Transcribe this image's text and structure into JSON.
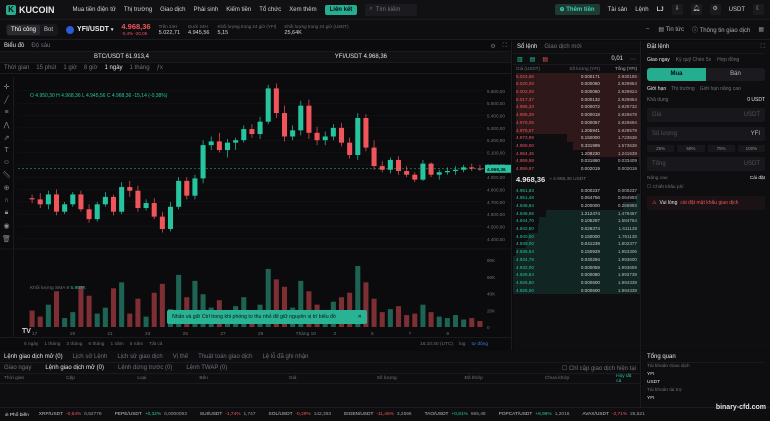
{
  "topnav": {
    "logo": "KUCOIN",
    "items": [
      "Mua tiền điện tử",
      "Thị trường",
      "Giao dịch",
      "Phái sinh",
      "Kiếm tiền",
      "Tổ chức",
      "Xem thêm"
    ],
    "link": "Liên kết",
    "search_placeholder": "Tìm kiếm",
    "deposit": "Thêm tiền",
    "assets": "Tài sản",
    "orders": "Lệnh",
    "user": "LJ",
    "currency": "USDT"
  },
  "tickerbar": {
    "tab_main": "Thủ công",
    "tab_bot": "Bot",
    "pair": "YFI/USDT",
    "price": "4.968,36",
    "change": "-0,4% -20,05",
    "stats": [
      {
        "k": "Trên 24H",
        "v": "5.022,71"
      },
      {
        "k": "Dưới 24H",
        "v": "4.945,56"
      },
      {
        "k": "Khối lượng trong 24 giờ (YFI)",
        "v": "5,15"
      },
      {
        "k": "Khối lượng trong 24 giờ (USDT)",
        "v": "25,64K"
      }
    ],
    "news": "Tin tức",
    "info": "Thông tin giao dịch"
  },
  "chart": {
    "tabs": [
      "Biểu đồ",
      "Độ sâu"
    ],
    "symbol_left": "BTC/USDT 61.913,4",
    "symbol_mid": "YFI/USDT 4.968,36",
    "intervals": [
      "Thời gian",
      "15 phút",
      "1 giờ",
      "8 giờ",
      "1 ngày",
      "1 tháng"
    ],
    "ohlc": "O 4.950,30 H 4.968,36 L 4.945,56 C 4.968,36 -15,14 (-0,38%)",
    "volume_label": "Khối lượng SMA 9",
    "volume_value": "5.907K",
    "current_price_tag": "4.968,36",
    "timestamp": "16:10:40 (UTC)",
    "range_buttons": [
      "5 ngày",
      "1 tháng",
      "3 tháng",
      "6 tháng",
      "1 năm",
      "5 năm",
      "Tất cả"
    ],
    "log_label": "log",
    "auto_label": "tự động"
  },
  "chart_data": {
    "type": "candlestick",
    "x": [
      "17",
      "19",
      "21",
      "23",
      "25",
      "27",
      "29",
      "Tháng 10",
      "3",
      "5",
      "7",
      "9"
    ],
    "y_ticks": [
      "5.600,00",
      "5.500,00",
      "5.400,00",
      "5.300,00",
      "5.200,00",
      "5.100,00",
      "5.000,00",
      "4.900,00",
      "4.800,00",
      "4.700,00",
      "4.600,00",
      "4.500,00",
      "4.400,00"
    ],
    "vol_ticks": [
      "80K",
      "60K",
      "40K",
      "20K",
      "0"
    ],
    "ylim": [
      4350,
      5680
    ],
    "candles": [
      [
        4730,
        4760,
        4690,
        4720
      ],
      [
        4720,
        4770,
        4650,
        4680
      ],
      [
        4680,
        4790,
        4640,
        4760
      ],
      [
        4760,
        4800,
        4590,
        4620
      ],
      [
        4620,
        4700,
        4600,
        4680
      ],
      [
        4680,
        4780,
        4660,
        4760
      ],
      [
        4760,
        4790,
        4620,
        4640
      ],
      [
        4640,
        4680,
        4530,
        4560
      ],
      [
        4560,
        4700,
        4540,
        4680
      ],
      [
        4680,
        4780,
        4660,
        4740
      ],
      [
        4740,
        4760,
        4590,
        4620
      ],
      [
        4620,
        4860,
        4600,
        4820
      ],
      [
        4820,
        4870,
        4740,
        4790
      ],
      [
        4790,
        4830,
        4620,
        4650
      ],
      [
        4650,
        4720,
        4630,
        4690
      ],
      [
        4690,
        4730,
        4560,
        4580
      ],
      [
        4580,
        4620,
        4450,
        4480
      ],
      [
        4480,
        4700,
        4460,
        4660
      ],
      [
        4660,
        4900,
        4640,
        4870
      ],
      [
        4870,
        4900,
        4720,
        4750
      ],
      [
        4750,
        4920,
        4720,
        4890
      ],
      [
        4890,
        5200,
        4850,
        5160
      ],
      [
        5160,
        5230,
        5120,
        5190
      ],
      [
        5190,
        5260,
        5100,
        5120
      ],
      [
        5120,
        5210,
        5060,
        5180
      ],
      [
        5180,
        5220,
        5120,
        5200
      ],
      [
        5200,
        5320,
        5180,
        5290
      ],
      [
        5290,
        5330,
        5220,
        5250
      ],
      [
        5250,
        5390,
        5210,
        5350
      ],
      [
        5350,
        5650,
        5330,
        5620
      ],
      [
        5620,
        5660,
        5380,
        5420
      ],
      [
        5420,
        5480,
        5190,
        5230
      ],
      [
        5230,
        5320,
        5200,
        5280
      ],
      [
        5280,
        5520,
        5240,
        5480
      ],
      [
        5480,
        5530,
        5210,
        5260
      ],
      [
        5260,
        5310,
        5160,
        5200
      ],
      [
        5200,
        5270,
        5160,
        5230
      ],
      [
        5230,
        5330,
        5200,
        5300
      ],
      [
        5300,
        5340,
        5150,
        5180
      ],
      [
        5180,
        5220,
        5050,
        5080
      ],
      [
        5080,
        5420,
        5040,
        5380
      ],
      [
        5380,
        5410,
        5110,
        5140
      ],
      [
        5140,
        5200,
        4960,
        4990
      ],
      [
        4990,
        5030,
        4940,
        4960
      ],
      [
        4960,
        5060,
        4930,
        5040
      ],
      [
        5040,
        5070,
        4920,
        4950
      ],
      [
        4950,
        4990,
        4900,
        4920
      ],
      [
        4920,
        4940,
        4860,
        4880
      ],
      [
        4880,
        5040,
        4870,
        5010
      ],
      [
        5010,
        5020,
        4900,
        4920
      ],
      [
        4920,
        4960,
        4880,
        4940
      ],
      [
        4940,
        4980,
        4920,
        4950
      ],
      [
        4950,
        4990,
        4920,
        4960
      ],
      [
        4960,
        5000,
        4940,
        4980
      ],
      [
        4980,
        5010,
        4950,
        4970
      ],
      [
        4970,
        5000,
        4950,
        4968
      ]
    ],
    "volumes": [
      22,
      14,
      30,
      48,
      12,
      20,
      55,
      42,
      18,
      26,
      52,
      60,
      18,
      38,
      14,
      46,
      58,
      24,
      70,
      40,
      62,
      44,
      26,
      36,
      22,
      28,
      40,
      18,
      30,
      78,
      64,
      54,
      26,
      62,
      48,
      30,
      22,
      34,
      40,
      46,
      82,
      60,
      38,
      20,
      24,
      28,
      16,
      18,
      30,
      20,
      14,
      12,
      16,
      10,
      12,
      8
    ]
  },
  "orderbook": {
    "tabs": [
      "Sổ lệnh",
      "Giao dịch mới"
    ],
    "step": "0,01",
    "headers": [
      "Giá (USDT)",
      "Số lượng (YFI)",
      "Tổng (YFI)"
    ],
    "asks": [
      [
        "5.024,66",
        "0.000171",
        "2.930155"
      ],
      [
        "5.020,09",
        "0.000060",
        "2.929984"
      ],
      [
        "5.003,09",
        "0.000060",
        "2.929924"
      ],
      [
        "5.017,37",
        "0.000132",
        "2.929864"
      ],
      [
        "4.995,33",
        "0.000072",
        "2.929732"
      ],
      [
        "4.985,39",
        "0.000018",
        "2.929678"
      ],
      [
        "4.978,06",
        "0.000057",
        "2.929694"
      ],
      [
        "4.975,07",
        "1.205941",
        "2.929579"
      ],
      [
        "4.973,99",
        "0.150000",
        "1.723638"
      ],
      [
        "4.968,00",
        "0.331999",
        "1.573638"
      ],
      [
        "4.964,45",
        "1.208230",
        "1.241639"
      ],
      [
        "4.959,98",
        "0.031860",
        "0.033409"
      ],
      [
        "4.959,97",
        "0.002019",
        "0.002019"
      ]
    ],
    "mid_price": "4.968,36",
    "mid_sub": "≈ 4.968,36 USDT",
    "bids": [
      [
        "4.951,83",
        "0.000237",
        "0.000237"
      ],
      [
        "4.951,48",
        "0.064756",
        "0.064993"
      ],
      [
        "4.948,84",
        "0.200000",
        "0.266993"
      ],
      [
        "4.948,55",
        "1.212474",
        "1.479467"
      ],
      [
        "4.944,70",
        "0.105297",
        "1.584764"
      ],
      [
        "4.942,50",
        "0.026374",
        "1.611138"
      ],
      [
        "4.940,00",
        "0.150000",
        "1.761138"
      ],
      [
        "4.939,00",
        "0.041239",
        "1.802377"
      ],
      [
        "4.936,64",
        "0.150929",
        "1.953306"
      ],
      [
        "4.934,78",
        "0.040294",
        "1.993600"
      ],
      [
        "4.932,00",
        "0.000059",
        "1.993659"
      ],
      [
        "4.928,84",
        "0.000080",
        "1.993739"
      ],
      [
        "4.926,80",
        "0.000600",
        "1.994339"
      ],
      [
        "4.925,00",
        "0.000600",
        "1.994339"
      ]
    ]
  },
  "trade": {
    "title": "Đặt lệnh",
    "tabs": [
      "Giao ngay",
      "Ký quỹ Chéo 5x",
      "Hợp đồng"
    ],
    "buy": "Mua",
    "sell": "Bán",
    "order_types": [
      "Giới hạn",
      "Thị trường",
      "Giới hạn nâng cao"
    ],
    "available_label": "Khả dụng",
    "available_value": "0 USDT",
    "price_label": "Giá",
    "qty_label": "Số lượng",
    "total_label": "Tổng",
    "unit_usdt": "USDT",
    "unit_yfi": "YFI",
    "pcts": [
      "25%",
      "50%",
      "75%",
      "100%"
    ],
    "advanced": "Nâng cao",
    "settings": "Cài đặt",
    "fee": "Chiết khấu phí",
    "warning_prefix": "Vui lòng",
    "warning_link": "cài đặt mật khẩu giao dịch"
  },
  "bottom": {
    "tabs": [
      "Lệnh giao dịch mở (0)",
      "Lịch sử Lệnh",
      "Lịch sử giao dịch",
      "Vị thế",
      "Thuật toán giao dịch",
      "Lệ lỗ đã ghi nhận"
    ],
    "subtabs": [
      "Giao ngay",
      "Lệnh giao dịch mở (0)",
      "Lệnh dừng trước (0)",
      "Lệnh TWAP (0)"
    ],
    "check": "Chỉ cặp giao dịch hiện tại",
    "columns": [
      "Thời gian",
      "Cặp",
      "Loại",
      "Bên",
      "Giá",
      "Số lượng",
      "Đã khớp",
      "Chưa khớp",
      "Hủy tất cả"
    ]
  },
  "overview": {
    "title": "Tổng quan",
    "rows": [
      "Tài khoản Giao dịch",
      "YFI",
      "USDT",
      "Tài khoản tài trợ",
      "YFI"
    ]
  },
  "tickers": [
    {
      "label": "Phổ biến"
    },
    {
      "pair": "XRP/USDT",
      "ch": "-0,64%",
      "p": "0,52779",
      "up": false
    },
    {
      "pair": "PEPE/USDT",
      "ch": "+0,32%",
      "p": "0,0000093",
      "up": true
    },
    {
      "pair": "SUI/USDT",
      "ch": "-1,74%",
      "p": "1,747",
      "up": false
    },
    {
      "pair": "SOL/USDT",
      "ch": "-0,29%",
      "p": "142,393",
      "up": false
    },
    {
      "pair": "EIGEN/USDT",
      "ch": "-11,46%",
      "p": "3,2596",
      "up": false
    },
    {
      "pair": "TAO/USDT",
      "ch": "+0,81%",
      "p": "565,48",
      "up": true
    },
    {
      "pair": "POPCAT/USDT",
      "ch": "+6,98%",
      "p": "1,2016",
      "up": true
    },
    {
      "pair": "AVAX/USDT",
      "ch": "-2,71%",
      "p": "25,521",
      "up": false
    }
  ],
  "toast": "Nhấn và giữ Ctrl trong khi phóng to thu nhỏ để giữ nguyên vị trí biểu đồ",
  "watermark": "binary-cfd.com",
  "colors": {
    "up": "#26c5a0",
    "down": "#f0555b",
    "accent": "#24ae8f"
  }
}
